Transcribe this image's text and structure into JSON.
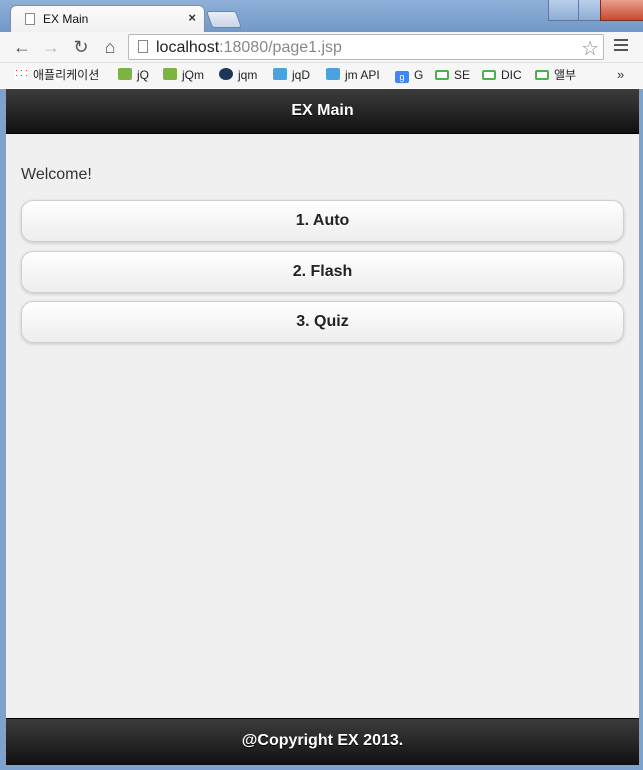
{
  "browser": {
    "tab_title": "EX Main",
    "tab_close": "×",
    "url_host": "localhost",
    "url_rest": ":18080/page1.jsp"
  },
  "bookmarks": [
    {
      "label": "애플리케이션",
      "icon": "apps-icon"
    },
    {
      "label": "jQ",
      "icon": "w3-icon"
    },
    {
      "label": "jQm",
      "icon": "w3-icon"
    },
    {
      "label": "jqm",
      "icon": "jqm-icon"
    },
    {
      "label": "jqD",
      "icon": "jq-icon"
    },
    {
      "label": "jm API",
      "icon": "jq-icon"
    },
    {
      "label": "G",
      "icon": "google-icon"
    },
    {
      "label": "SE",
      "icon": "bookmark-icon"
    },
    {
      "label": "DIC",
      "icon": "bookmark-icon"
    },
    {
      "label": "앨부",
      "icon": "bookmark-icon"
    }
  ],
  "bookmarks_more": "»",
  "page": {
    "header_title": "EX Main",
    "welcome": "Welcome!",
    "buttons": [
      "1. Auto",
      "2. Flash",
      "3. Quiz"
    ],
    "footer": "@Copyright EX 2013."
  }
}
